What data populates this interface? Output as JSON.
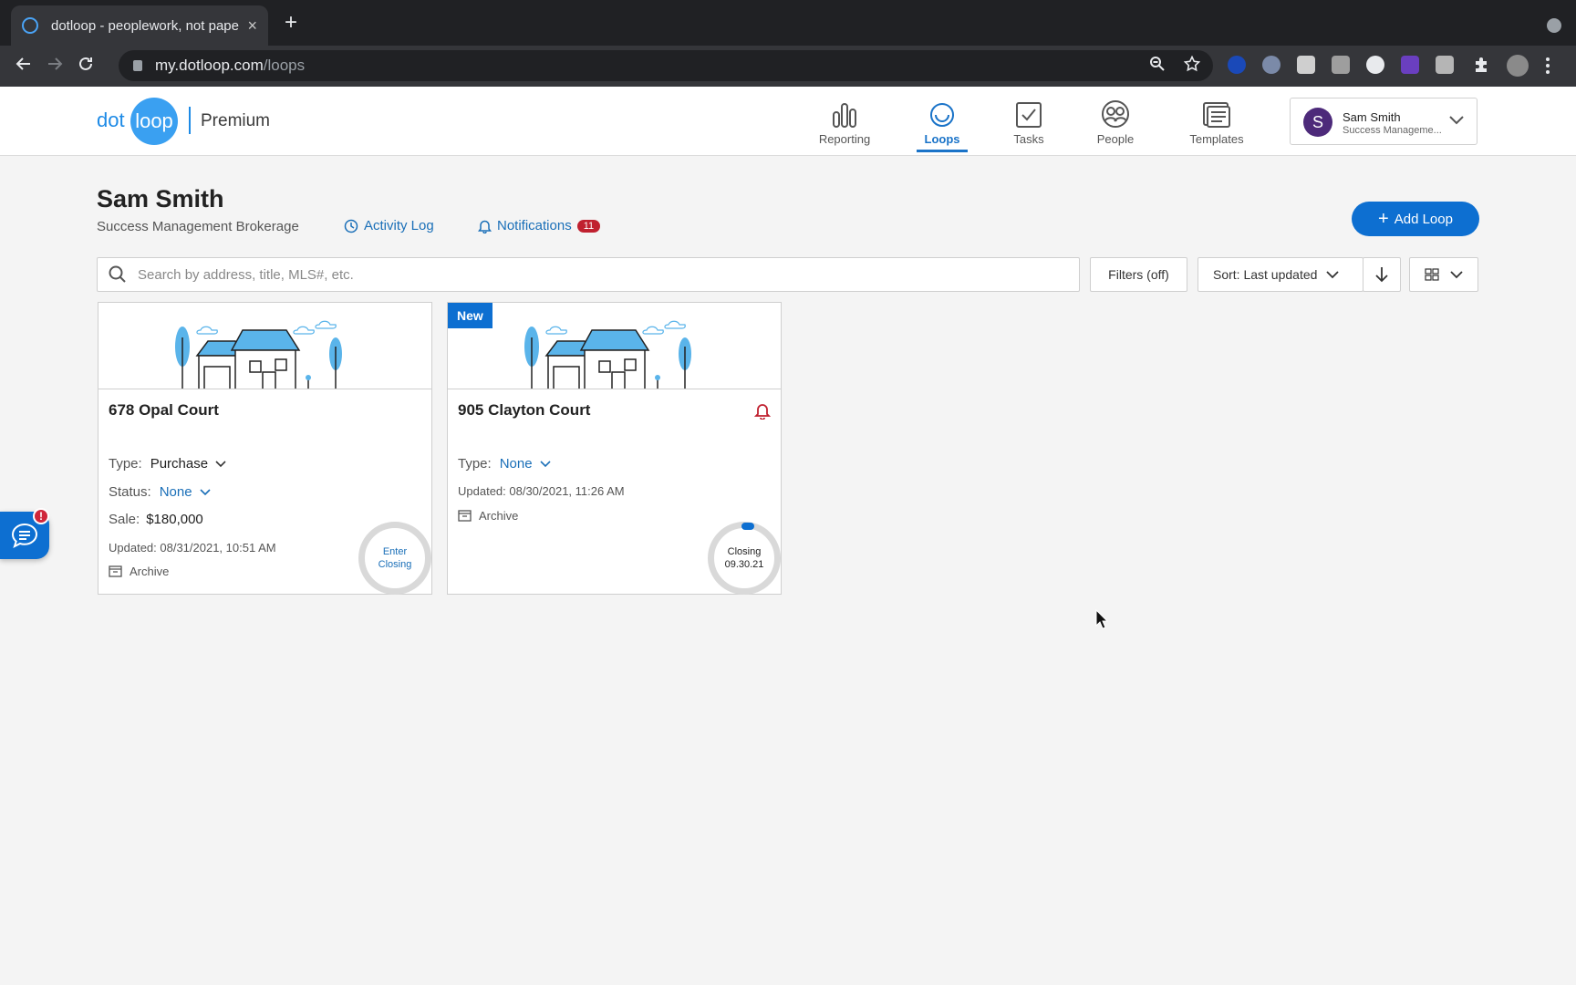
{
  "browser": {
    "tab_title": "dotloop - peoplework, not paperwork",
    "tab_close": "×",
    "new_tab": "+",
    "url_host": "my.dotloop.com",
    "url_path": "/loops"
  },
  "app": {
    "logo_dot": "dot",
    "logo_loop": "loop",
    "plan": "Premium",
    "nav": {
      "reporting": "Reporting",
      "loops": "Loops",
      "tasks": "Tasks",
      "people": "People",
      "templates": "Templates"
    },
    "user": {
      "initial": "S",
      "name": "Sam Smith",
      "org": "Success Manageme..."
    }
  },
  "page": {
    "name": "Sam Smith",
    "org": "Success Management Brokerage",
    "activity_log": "Activity Log",
    "notifications": "Notifications",
    "notifications_count": "11",
    "add_loop": "Add Loop",
    "search_placeholder": "Search by address, title, MLS#, etc.",
    "filters": "Filters (off)",
    "sort": "Sort: Last updated"
  },
  "loops": [
    {
      "address": "678 Opal Court",
      "type_label": "Type:",
      "type_value": "Purchase",
      "status_label": "Status:",
      "status_value": "None",
      "sale_label": "Sale:",
      "sale_value": "$180,000",
      "updated": "Updated: 08/31/2021, 10:51 AM",
      "archive": "Archive",
      "ring_line1": "Enter",
      "ring_line2": "Closing"
    },
    {
      "badge": "New",
      "address": "905 Clayton Court",
      "type_label": "Type:",
      "type_value": "None",
      "updated": "Updated: 08/30/2021, 11:26 AM",
      "archive": "Archive",
      "ring_line1": "Closing",
      "ring_line2": "09.30.21"
    }
  ],
  "chat": {
    "alert": "!"
  },
  "colors": {
    "brand_blue": "#0d6fd1",
    "alert_red": "#c0202f"
  }
}
